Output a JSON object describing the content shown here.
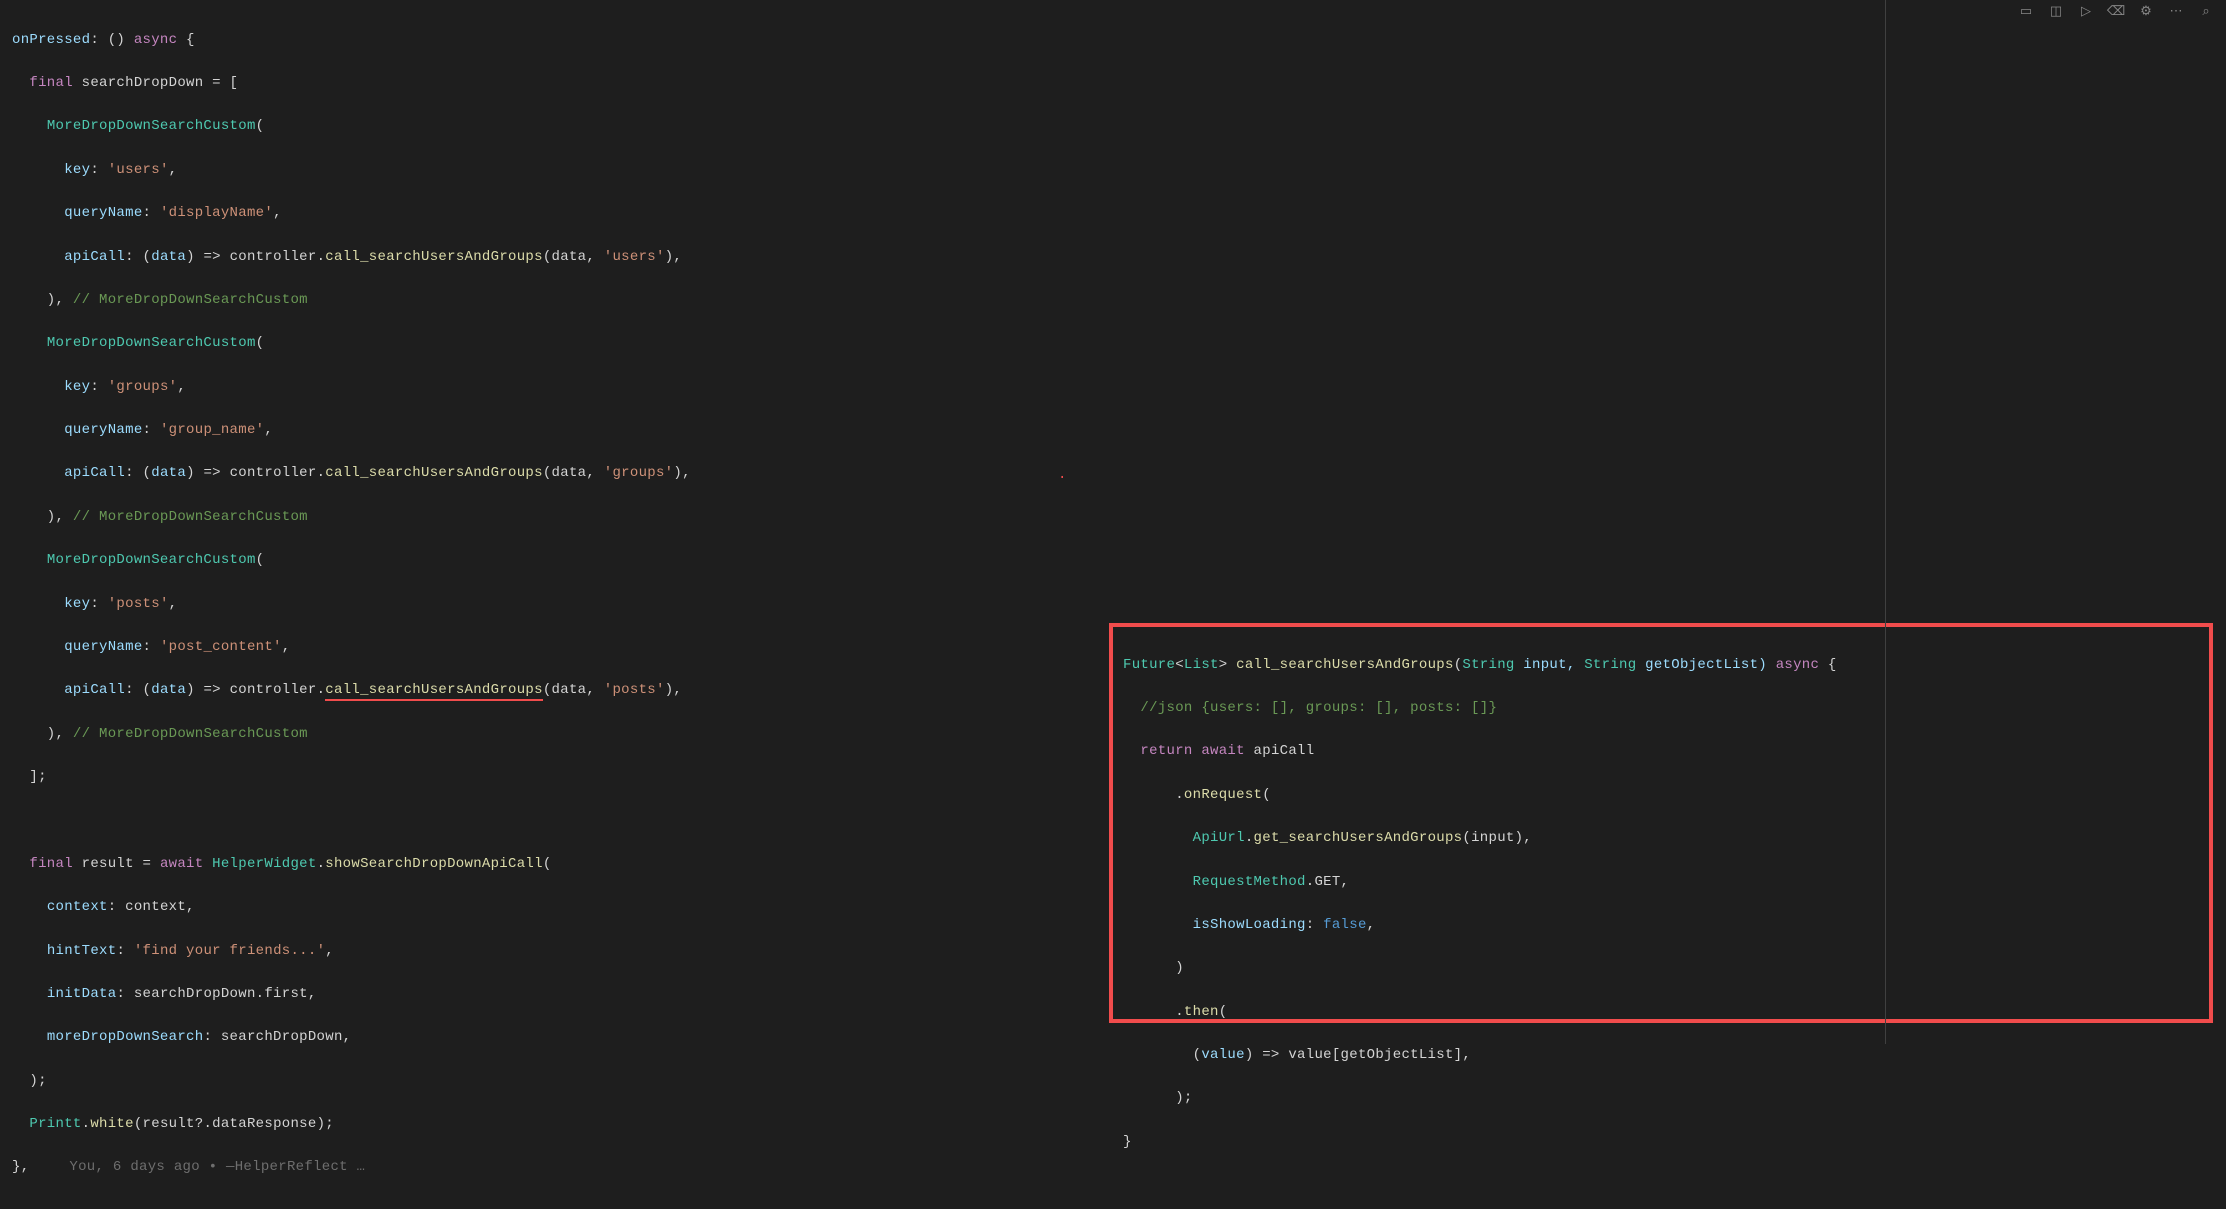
{
  "code": {
    "l1": {
      "a": "onPressed",
      "b": ": () ",
      "c": "async",
      "d": " {"
    },
    "l2": {
      "a": "  ",
      "b": "final",
      "c": " searchDropDown = ["
    },
    "l3": {
      "a": "    ",
      "b": "MoreDropDownSearchCustom",
      "c": "("
    },
    "l4": {
      "a": "      ",
      "b": "key",
      "c": ": ",
      "d": "'users'",
      "e": ","
    },
    "l5": {
      "a": "      ",
      "b": "queryName",
      "c": ": ",
      "d": "'displayName'",
      "e": ","
    },
    "l6": {
      "a": "      ",
      "b": "apiCall",
      "c": ": (",
      "d": "data",
      "e": ") => controller.",
      "f": "call_searchUsersAndGroups",
      "g": "(data, ",
      "h": "'users'",
      "i": "),"
    },
    "l7": {
      "a": "    ), ",
      "b": "// MoreDropDownSearchCustom"
    },
    "l8": {
      "a": "    ",
      "b": "MoreDropDownSearchCustom",
      "c": "("
    },
    "l9": {
      "a": "      ",
      "b": "key",
      "c": ": ",
      "d": "'groups'",
      "e": ","
    },
    "l10": {
      "a": "      ",
      "b": "queryName",
      "c": ": ",
      "d": "'group_name'",
      "e": ","
    },
    "l11": {
      "a": "      ",
      "b": "apiCall",
      "c": ": (",
      "d": "data",
      "e": ") => controller.",
      "f": "call_searchUsersAndGroups",
      "g": "(data, ",
      "h": "'groups'",
      "i": "),"
    },
    "l12": {
      "a": "    ), ",
      "b": "// MoreDropDownSearchCustom"
    },
    "l13": {
      "a": "    ",
      "b": "MoreDropDownSearchCustom",
      "c": "("
    },
    "l14": {
      "a": "      ",
      "b": "key",
      "c": ": ",
      "d": "'posts'",
      "e": ","
    },
    "l15": {
      "a": "      ",
      "b": "queryName",
      "c": ": ",
      "d": "'post_content'",
      "e": ","
    },
    "l16": {
      "a": "      ",
      "b": "apiCall",
      "c": ": (",
      "d": "data",
      "e": ") => controller.",
      "f": "call_searchUsersAndGroups",
      "g": "(data, ",
      "h": "'posts'",
      "i": "),"
    },
    "l17": {
      "a": "    ), ",
      "b": "// MoreDropDownSearchCustom"
    },
    "l18": {
      "a": "  ];"
    },
    "l19": {
      "a": ""
    },
    "l20": {
      "a": "  ",
      "b": "final",
      "c": " result = ",
      "d": "await",
      "e": " ",
      "f": "HelperWidget",
      "g": ".",
      "h": "showSearchDropDownApiCall",
      "i": "("
    },
    "l21": {
      "a": "    ",
      "b": "context",
      "c": ": context,"
    },
    "l22": {
      "a": "    ",
      "b": "hintText",
      "c": ": ",
      "d": "'find your friends...'",
      "e": ","
    },
    "l23": {
      "a": "    ",
      "b": "initData",
      "c": ": searchDropDown.first,"
    },
    "l24": {
      "a": "    ",
      "b": "moreDropDownSearch",
      "c": ": searchDropDown,"
    },
    "l25": {
      "a": "  );"
    },
    "l26": {
      "a": "  ",
      "b": "Printt",
      "c": ".",
      "d": "white",
      "e": "(result?.dataResponse);"
    },
    "l27": {
      "a": "},",
      "b": "You, 6 days ago • —HelperReflect …"
    }
  },
  "inset": {
    "l1": {
      "a": "Future",
      "b": "<",
      "c": "List",
      "d": "> ",
      "e": "call_searchUsersAndGroups",
      "f": "(",
      "g": "String",
      "h": " input, ",
      "i": "String",
      "j": " getObjectList) ",
      "k": "async",
      "l": " {"
    },
    "l2": {
      "a": "  ",
      "b": "//json {users: [], groups: [], posts: []}"
    },
    "l3": {
      "a": "  ",
      "b": "return",
      "c": " ",
      "d": "await",
      "e": " apiCall"
    },
    "l4": {
      "a": "      .",
      "b": "onRequest",
      "c": "("
    },
    "l5": {
      "a": "        ",
      "b": "ApiUrl",
      "c": ".",
      "d": "get_searchUsersAndGroups",
      "e": "(input),"
    },
    "l6": {
      "a": "        ",
      "b": "RequestMethod",
      "c": ".GET,"
    },
    "l7": {
      "a": "        ",
      "b": "isShowLoading",
      "c": ": ",
      "d": "false",
      "e": ","
    },
    "l8": {
      "a": "      )"
    },
    "l9": {
      "a": "      .",
      "b": "then",
      "c": "("
    },
    "l10": {
      "a": "        (",
      "b": "value",
      "c": ") => value[getObjectList],"
    },
    "l11": {
      "a": "      );"
    },
    "l12": {
      "a": "}"
    }
  },
  "toolbar": {
    "icons": [
      "layout",
      "split",
      "play",
      "bug",
      "settings",
      "more",
      "search"
    ]
  }
}
